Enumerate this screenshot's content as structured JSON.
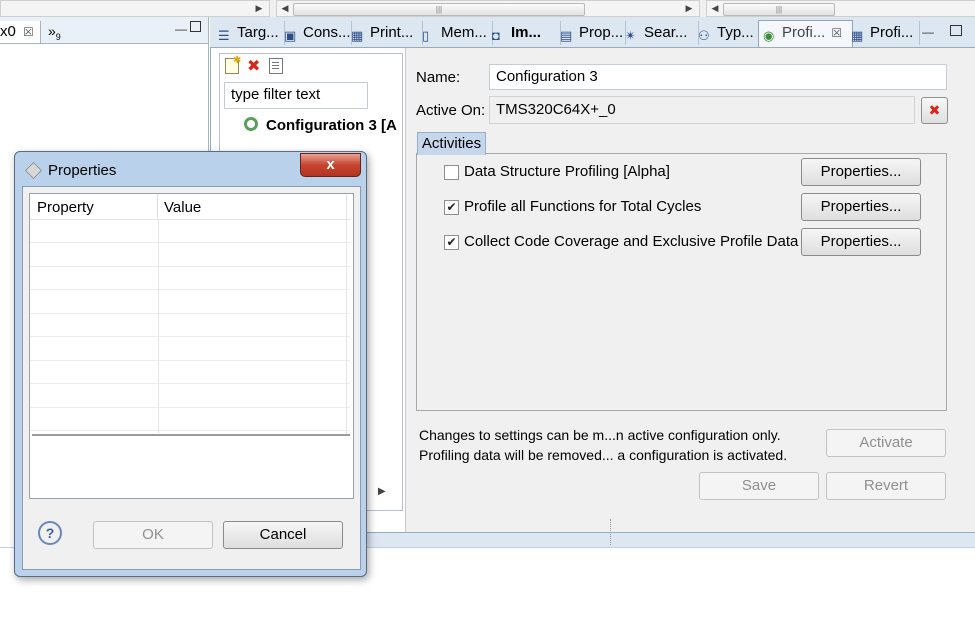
{
  "left_view": {
    "tab_label": "x0",
    "overflow_label": "»",
    "overflow_count": "9"
  },
  "tabs": [
    {
      "label": "Targ...",
      "icon": "target-icon"
    },
    {
      "label": "Cons...",
      "icon": "console-icon"
    },
    {
      "label": "Print...",
      "icon": "table-icon"
    },
    {
      "label": "Mem...",
      "icon": "memory-icon"
    },
    {
      "label": "Im...",
      "icon": "camera-icon"
    },
    {
      "label": "Prop...",
      "icon": "properties-icon"
    },
    {
      "label": "Sear...",
      "icon": "search-icon"
    },
    {
      "label": "Typ...",
      "icon": "hierarchy-icon"
    },
    {
      "label": "Profi...",
      "icon": "profile-icon",
      "active": true
    },
    {
      "label": "Profi...",
      "icon": "table-icon"
    }
  ],
  "config_list": {
    "filter_placeholder": "type filter text",
    "item_label": "Configuration 3  [A"
  },
  "form": {
    "name_label": "Name:",
    "name_value": "Configuration 3",
    "active_on_label": "Active On:",
    "active_on_value": "TMS320C64X+_0",
    "activities_tab": "Activities",
    "activities": [
      {
        "label": "Data Structure Profiling [Alpha]",
        "checked": false,
        "button": "Properties..."
      },
      {
        "label": "Profile all Functions for Total Cycles",
        "checked": true,
        "button": "Properties..."
      },
      {
        "label": "Collect Code Coverage and Exclusive Profile Data",
        "checked": true,
        "button": "Properties..."
      }
    ],
    "note_line1": "Changes to settings can be m...n active configuration only.",
    "note_line2": "Profiling data will be removed... a configuration is activated.",
    "activate_label": "Activate",
    "save_label": "Save",
    "revert_label": "Revert"
  },
  "dialog": {
    "title": "Properties",
    "col_property": "Property",
    "col_value": "Value",
    "ok_label": "OK",
    "cancel_label": "Cancel",
    "help_glyph": "?",
    "close_glyph": "x"
  },
  "colors": {
    "delete_red": "#d9261c",
    "dialog_frame": "#b9d1ea",
    "close_button": "#c54531"
  }
}
